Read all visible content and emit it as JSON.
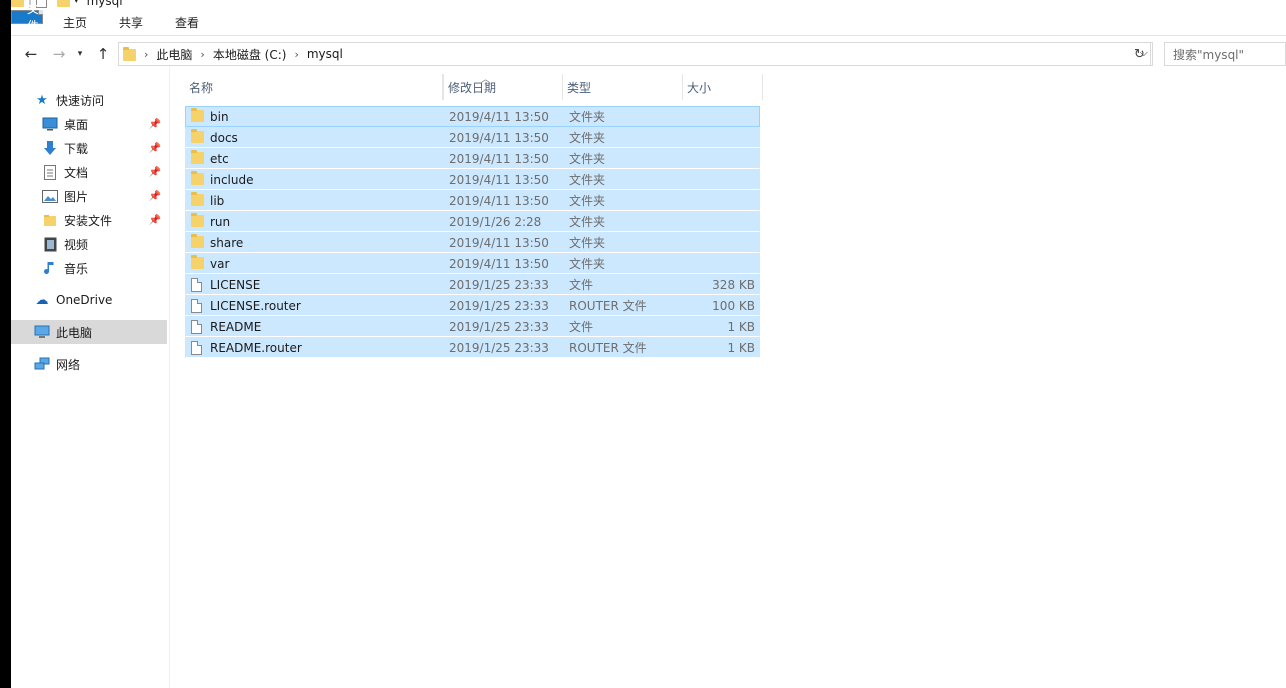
{
  "window": {
    "title": "mysql"
  },
  "ribbon": {
    "tabs": [
      "文件",
      "主页",
      "共享",
      "查看"
    ]
  },
  "address": {
    "crumbs": [
      "此电脑",
      "本地磁盘 (C:)",
      "mysql"
    ],
    "search_placeholder": "搜索\"mysql\""
  },
  "nav": {
    "quick_access": "快速访问",
    "items": [
      {
        "label": "桌面",
        "icon": "desktop-icon",
        "pinned": true
      },
      {
        "label": "下载",
        "icon": "download-icon",
        "pinned": true
      },
      {
        "label": "文档",
        "icon": "document-icon",
        "pinned": true
      },
      {
        "label": "图片",
        "icon": "picture-icon",
        "pinned": true
      },
      {
        "label": "安装文件",
        "icon": "folder-icon",
        "pinned": true
      },
      {
        "label": "视频",
        "icon": "video-icon",
        "pinned": false
      },
      {
        "label": "音乐",
        "icon": "music-icon",
        "pinned": false
      }
    ],
    "onedrive": "OneDrive",
    "this_pc": "此电脑",
    "network": "网络"
  },
  "columns": {
    "name": "名称",
    "date": "修改日期",
    "type": "类型",
    "size": "大小"
  },
  "files": [
    {
      "name": "bin",
      "date": "2019/4/11 13:50",
      "type": "文件夹",
      "size": "",
      "kind": "folder"
    },
    {
      "name": "docs",
      "date": "2019/4/11 13:50",
      "type": "文件夹",
      "size": "",
      "kind": "folder"
    },
    {
      "name": "etc",
      "date": "2019/4/11 13:50",
      "type": "文件夹",
      "size": "",
      "kind": "folder"
    },
    {
      "name": "include",
      "date": "2019/4/11 13:50",
      "type": "文件夹",
      "size": "",
      "kind": "folder"
    },
    {
      "name": "lib",
      "date": "2019/4/11 13:50",
      "type": "文件夹",
      "size": "",
      "kind": "folder"
    },
    {
      "name": "run",
      "date": "2019/1/26 2:28",
      "type": "文件夹",
      "size": "",
      "kind": "folder"
    },
    {
      "name": "share",
      "date": "2019/4/11 13:50",
      "type": "文件夹",
      "size": "",
      "kind": "folder"
    },
    {
      "name": "var",
      "date": "2019/4/11 13:50",
      "type": "文件夹",
      "size": "",
      "kind": "folder"
    },
    {
      "name": "LICENSE",
      "date": "2019/1/25 23:33",
      "type": "文件",
      "size": "328 KB",
      "kind": "file"
    },
    {
      "name": "LICENSE.router",
      "date": "2019/1/25 23:33",
      "type": "ROUTER 文件",
      "size": "100 KB",
      "kind": "file"
    },
    {
      "name": "README",
      "date": "2019/1/25 23:33",
      "type": "文件",
      "size": "1 KB",
      "kind": "file"
    },
    {
      "name": "README.router",
      "date": "2019/1/25 23:33",
      "type": "ROUTER 文件",
      "size": "1 KB",
      "kind": "file"
    }
  ],
  "colors": {
    "accent": "#1979ca",
    "selection": "#cce8ff",
    "selection_border": "#99d1ff"
  }
}
